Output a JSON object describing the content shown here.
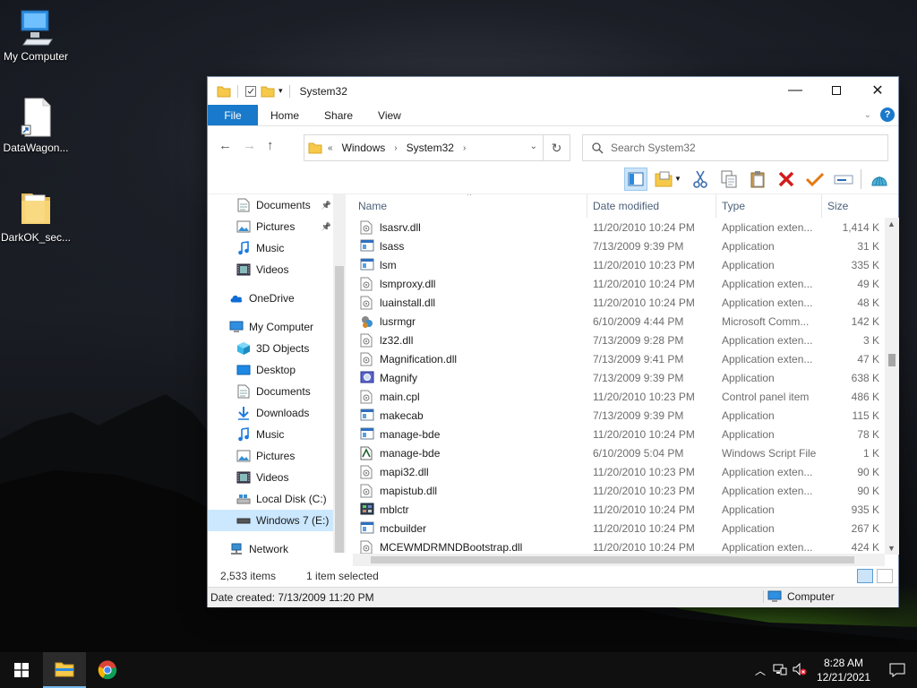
{
  "desktop": {
    "icons": [
      {
        "label": "My Computer"
      },
      {
        "label": "DataWagon..."
      },
      {
        "label": "DarkOK_sec..."
      }
    ]
  },
  "window": {
    "title": "System32",
    "ribbon": {
      "file": "File",
      "home": "Home",
      "share": "Share",
      "view": "View"
    },
    "breadcrumb": {
      "overflow": "«",
      "parts": [
        "Windows",
        "System32"
      ]
    },
    "search": {
      "placeholder": "Search System32"
    },
    "nav": [
      {
        "label": "Documents",
        "pinned": true,
        "icon": "documents-icon"
      },
      {
        "label": "Pictures",
        "pinned": true,
        "icon": "pictures-icon"
      },
      {
        "label": "Music",
        "icon": "music-icon"
      },
      {
        "label": "Videos",
        "icon": "videos-icon"
      },
      {
        "label": "OneDrive",
        "icon": "onedrive-icon"
      },
      {
        "label": "My Computer",
        "icon": "computer-icon"
      },
      {
        "label": "3D Objects",
        "icon": "3d-objects-icon"
      },
      {
        "label": "Desktop",
        "icon": "desktop-icon"
      },
      {
        "label": "Documents",
        "icon": "documents-icon"
      },
      {
        "label": "Downloads",
        "icon": "downloads-icon"
      },
      {
        "label": "Music",
        "icon": "music-icon"
      },
      {
        "label": "Pictures",
        "icon": "pictures-icon"
      },
      {
        "label": "Videos",
        "icon": "videos-icon"
      },
      {
        "label": "Local Disk (C:)",
        "icon": "local-disk-icon"
      },
      {
        "label": "Windows 7 (E:)",
        "icon": "drive-icon",
        "selected": true
      },
      {
        "label": "Network",
        "icon": "network-icon"
      }
    ],
    "columns": {
      "name": "Name",
      "date": "Date modified",
      "type": "Type",
      "size": "Size"
    },
    "files": [
      {
        "name": "lsasrv.dll",
        "date": "11/20/2010 10:24 PM",
        "type": "Application exten...",
        "size": "1,414 K",
        "icon": "dll"
      },
      {
        "name": "lsass",
        "date": "7/13/2009 9:39 PM",
        "type": "Application",
        "size": "31 K",
        "icon": "exe"
      },
      {
        "name": "lsm",
        "date": "11/20/2010 10:23 PM",
        "type": "Application",
        "size": "335 K",
        "icon": "exe"
      },
      {
        "name": "lsmproxy.dll",
        "date": "11/20/2010 10:24 PM",
        "type": "Application exten...",
        "size": "49 K",
        "icon": "dll"
      },
      {
        "name": "luainstall.dll",
        "date": "11/20/2010 10:24 PM",
        "type": "Application exten...",
        "size": "48 K",
        "icon": "dll"
      },
      {
        "name": "lusrmgr",
        "date": "6/10/2009 4:44 PM",
        "type": "Microsoft Comm...",
        "size": "142 K",
        "icon": "msc"
      },
      {
        "name": "lz32.dll",
        "date": "7/13/2009 9:28 PM",
        "type": "Application exten...",
        "size": "3 K",
        "icon": "dll"
      },
      {
        "name": "Magnification.dll",
        "date": "7/13/2009 9:41 PM",
        "type": "Application exten...",
        "size": "47 K",
        "icon": "dll"
      },
      {
        "name": "Magnify",
        "date": "7/13/2009 9:39 PM",
        "type": "Application",
        "size": "638 K",
        "icon": "magnify"
      },
      {
        "name": "main.cpl",
        "date": "11/20/2010 10:23 PM",
        "type": "Control panel item",
        "size": "486 K",
        "icon": "dll"
      },
      {
        "name": "makecab",
        "date": "7/13/2009 9:39 PM",
        "type": "Application",
        "size": "115 K",
        "icon": "exe"
      },
      {
        "name": "manage-bde",
        "date": "11/20/2010 10:24 PM",
        "type": "Application",
        "size": "78 K",
        "icon": "exe"
      },
      {
        "name": "manage-bde",
        "date": "6/10/2009 5:04 PM",
        "type": "Windows Script File",
        "size": "1 K",
        "icon": "script"
      },
      {
        "name": "mapi32.dll",
        "date": "11/20/2010 10:23 PM",
        "type": "Application exten...",
        "size": "90 K",
        "icon": "dll"
      },
      {
        "name": "mapistub.dll",
        "date": "11/20/2010 10:23 PM",
        "type": "Application exten...",
        "size": "90 K",
        "icon": "dll"
      },
      {
        "name": "mblctr",
        "date": "11/20/2010 10:24 PM",
        "type": "Application",
        "size": "935 K",
        "icon": "mblctr"
      },
      {
        "name": "mcbuilder",
        "date": "11/20/2010 10:24 PM",
        "type": "Application",
        "size": "267 K",
        "icon": "exe"
      },
      {
        "name": "MCEWMDRMNDBootstrap.dll",
        "date": "11/20/2010 10:24 PM",
        "type": "Application exten...",
        "size": "424 K",
        "icon": "dll"
      }
    ],
    "status": {
      "count": "2,533 items",
      "selected": "1 item selected"
    },
    "details": {
      "created": "Date created: 7/13/2009 11:20 PM",
      "location": "Computer"
    }
  },
  "taskbar": {
    "time": "8:28 AM",
    "date": "12/21/2021"
  },
  "colors": {
    "accent": "#1979ca",
    "selection": "#cce8ff"
  }
}
